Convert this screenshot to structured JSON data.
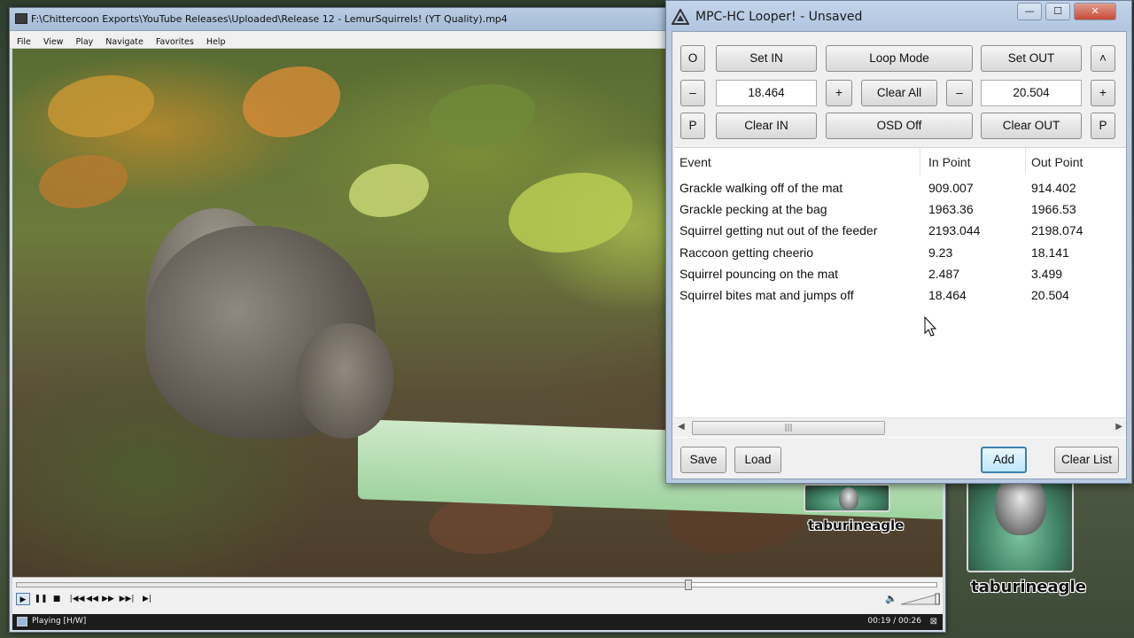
{
  "player": {
    "title": "F:\\Chittercoon Exports\\YouTube Releases\\Uploaded\\Release 12 - LemurSquirrels! (YT Quality).mp4",
    "menu": [
      "File",
      "View",
      "Play",
      "Navigate",
      "Favorites",
      "Help"
    ],
    "seek_progress": 0.73,
    "controls": {
      "play": "▶",
      "pause": "❚❚",
      "stop": "■",
      "skip_back": "|◀◀",
      "rewind": "◀◀",
      "forward": "▶▶",
      "skip_fwd": "▶▶|",
      "frame_step": "▶|"
    },
    "volume_icon": "speaker-icon",
    "status": "Playing [H/W]",
    "time": "00:19 / 00:26"
  },
  "looper": {
    "title": "MPC-HC Looper! - Unsaved",
    "buttons": {
      "o": "O",
      "set_in": "Set IN",
      "loop_mode": "Loop Mode",
      "set_out": "Set OUT",
      "up": "˄",
      "in_minus": "–",
      "in_plus": "+",
      "clear_all": "Clear All",
      "out_minus": "–",
      "out_plus": "+",
      "p_left": "P",
      "clear_in": "Clear IN",
      "osd_off": "OSD Off",
      "clear_out": "Clear OUT",
      "p_right": "P",
      "save": "Save",
      "load": "Load",
      "add": "Add",
      "clear_list": "Clear List"
    },
    "in_value": "18.464",
    "out_value": "20.504",
    "list": {
      "columns": [
        "Event",
        "In Point",
        "Out Point"
      ],
      "rows": [
        [
          "Grackle walking off of the mat",
          "909.007",
          "914.402"
        ],
        [
          "Grackle pecking at the bag",
          "1963.36",
          "1966.53"
        ],
        [
          "Squirrel getting nut out of the feeder",
          "2193.044",
          "2198.074"
        ],
        [
          "Raccoon getting cheerio",
          "9.23",
          "18.141"
        ],
        [
          "Squirrel pouncing on the mat",
          "2.487",
          "3.499"
        ],
        [
          "Squirrel bites mat and jumps off",
          "18.464",
          "20.504"
        ]
      ],
      "scroll_grip": "|||"
    }
  },
  "watermark": {
    "small": "taburineagle",
    "large": "taburineagle"
  }
}
